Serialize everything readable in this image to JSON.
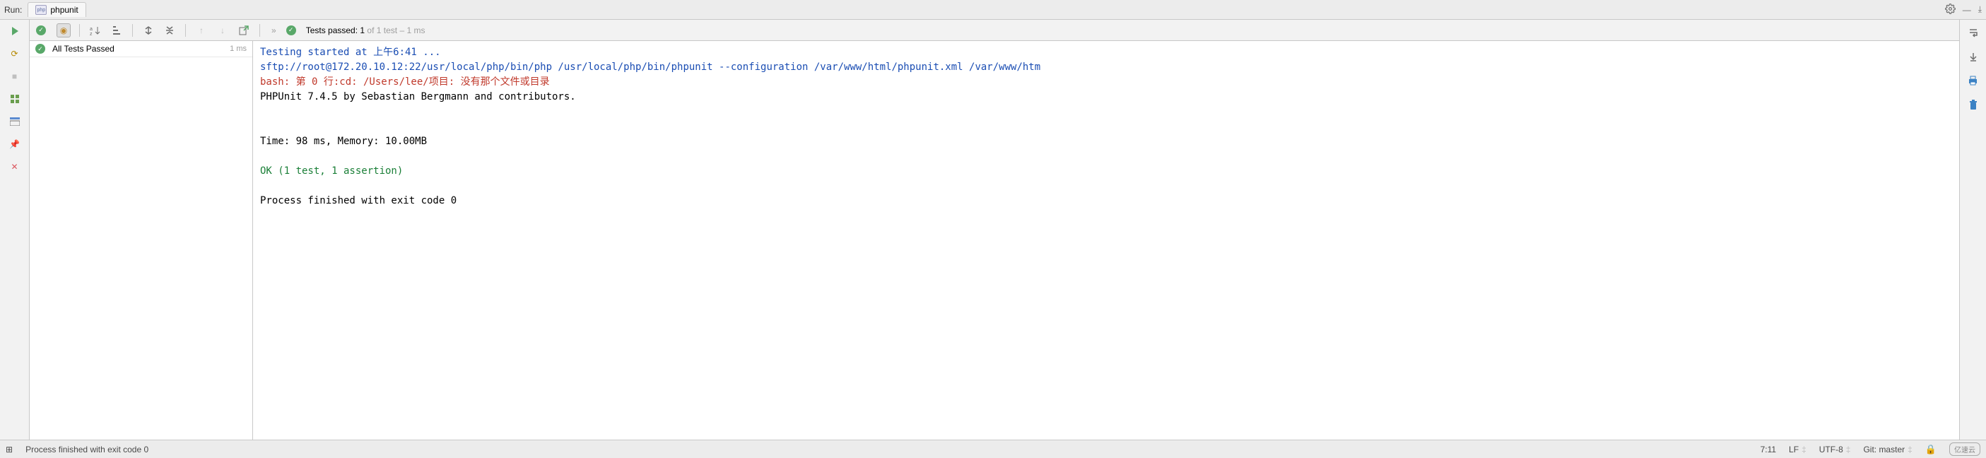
{
  "header": {
    "run_label": "Run:",
    "tab_name": "phpunit"
  },
  "toolbar": {
    "tests_passed_prefix": "Tests passed: 1",
    "tests_passed_suffix": " of 1 test – 1 ms"
  },
  "tree": {
    "root_label": "All Tests Passed",
    "root_time": "1 ms"
  },
  "console": {
    "line1": "Testing started at 上午6:41 ...",
    "line2": "sftp://root@172.20.10.12:22/usr/local/php/bin/php /usr/local/php/bin/phpunit --configuration /var/www/html/phpunit.xml /var/www/htm",
    "line3": "bash: 第 0 行:cd: /Users/lee/项目: 没有那个文件或目录",
    "line4": "PHPUnit 7.4.5 by Sebastian Bergmann and contributors.",
    "line5": "",
    "line6": "",
    "line7": "Time: 98 ms, Memory: 10.00MB",
    "line8": "",
    "line9": "OK (1 test, 1 assertion)",
    "line10": "",
    "line11": "Process finished with exit code 0"
  },
  "status": {
    "left_icon": "⊞",
    "message": "Process finished with exit code 0",
    "caret": "7:11",
    "line_sep": "LF",
    "encoding": "UTF-8",
    "git": "Git: master",
    "watermark": "亿速云"
  }
}
